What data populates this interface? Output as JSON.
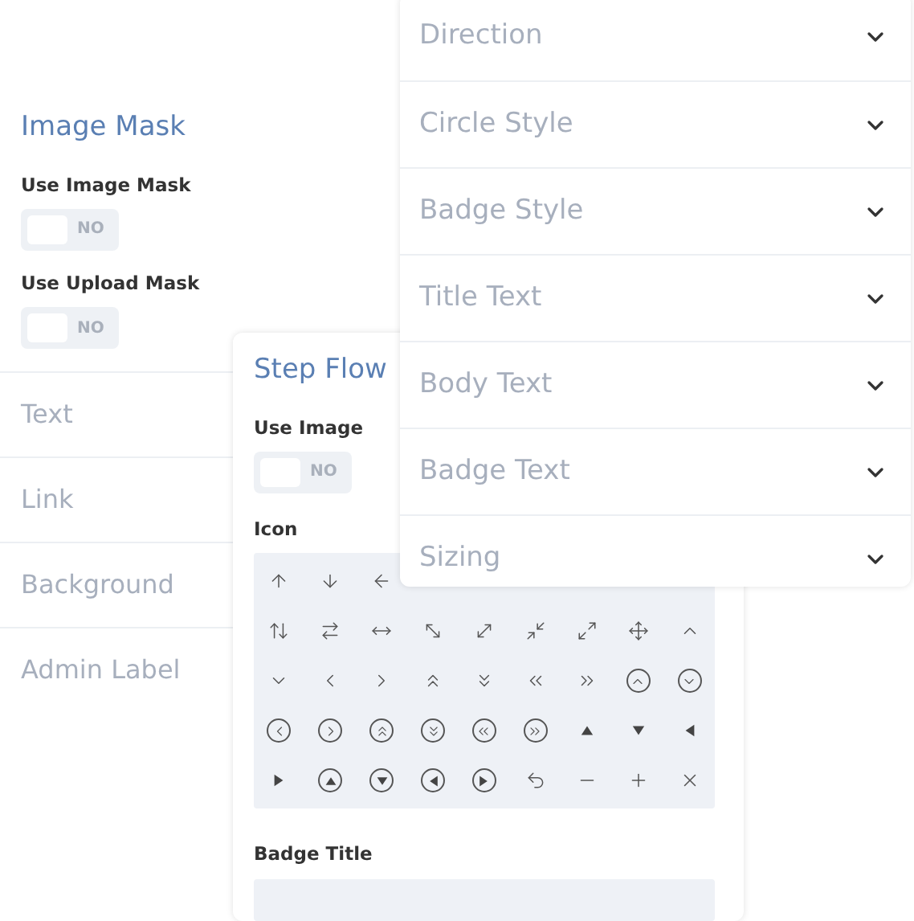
{
  "image_mask_panel": {
    "title": "Image Mask",
    "toggles": [
      {
        "label": "Use Image Mask",
        "on": false,
        "state_text": "NO"
      },
      {
        "label": "Use Upload Mask",
        "on": false,
        "state_text": "NO"
      }
    ],
    "sections": [
      "Text",
      "Link",
      "Background",
      "Admin Label"
    ]
  },
  "step_flow_panel": {
    "title": "Step Flow",
    "toggle": {
      "label": "Use Image",
      "on": false,
      "state_text": "NO"
    },
    "icon_label": "Icon",
    "icon_rows": [
      [
        {
          "kind": "arrow-up",
          "selected": false
        },
        {
          "kind": "arrow-down",
          "selected": false
        },
        {
          "kind": "arrow-left",
          "selected": false
        }
      ],
      [
        {
          "kind": "arrows-up-down",
          "selected": false
        },
        {
          "kind": "arrows-right-left",
          "selected": false
        },
        {
          "kind": "arrow-left-right",
          "selected": false
        },
        {
          "kind": "diagonal-nw-se",
          "selected": false
        },
        {
          "kind": "diagonal-ne-sw",
          "selected": false
        },
        {
          "kind": "compress",
          "selected": false
        },
        {
          "kind": "expand",
          "selected": false
        },
        {
          "kind": "move",
          "selected": false
        },
        {
          "kind": "chevron-up",
          "selected": false
        }
      ],
      [
        {
          "kind": "chevron-down",
          "selected": false
        },
        {
          "kind": "chevron-left",
          "selected": false
        },
        {
          "kind": "chevron-right",
          "selected": false
        },
        {
          "kind": "chevrons-up",
          "selected": false
        },
        {
          "kind": "chevrons-down",
          "selected": false
        },
        {
          "kind": "chevrons-left",
          "selected": false
        },
        {
          "kind": "chevrons-right",
          "selected": false
        },
        {
          "kind": "circle-chevron-up",
          "selected": false
        },
        {
          "kind": "circle-chevron-down",
          "selected": false
        }
      ],
      [
        {
          "kind": "circle-chevron-left",
          "selected": false
        },
        {
          "kind": "circle-chevron-right",
          "selected": false
        },
        {
          "kind": "circle-chevrons-up",
          "selected": false
        },
        {
          "kind": "circle-chevrons-down",
          "selected": false
        },
        {
          "kind": "circle-chevrons-left",
          "selected": false
        },
        {
          "kind": "circle-chevrons-right",
          "selected": false
        },
        {
          "kind": "triangle-up",
          "selected": false
        },
        {
          "kind": "triangle-down",
          "selected": false
        },
        {
          "kind": "triangle-left",
          "selected": false
        }
      ],
      [
        {
          "kind": "triangle-right",
          "selected": false
        },
        {
          "kind": "circle-triangle-up",
          "selected": false
        },
        {
          "kind": "circle-triangle-down",
          "selected": false
        },
        {
          "kind": "circle-triangle-left",
          "selected": false
        },
        {
          "kind": "circle-triangle-right",
          "selected": false
        },
        {
          "kind": "undo",
          "selected": false
        },
        {
          "kind": "minus",
          "selected": false
        },
        {
          "kind": "plus",
          "selected": false
        },
        {
          "kind": "close",
          "selected": false
        }
      ]
    ],
    "badge_title_label": "Badge Title"
  },
  "settings_panel": {
    "sections": [
      {
        "label": "Direction",
        "expanded": false
      },
      {
        "label": "Circle Style",
        "expanded": false
      },
      {
        "label": "Badge Style",
        "expanded": false
      },
      {
        "label": "Title Text",
        "expanded": false
      },
      {
        "label": "Body Text",
        "expanded": false
      },
      {
        "label": "Badge Text",
        "expanded": false
      },
      {
        "label": "Sizing",
        "expanded": false
      }
    ]
  }
}
